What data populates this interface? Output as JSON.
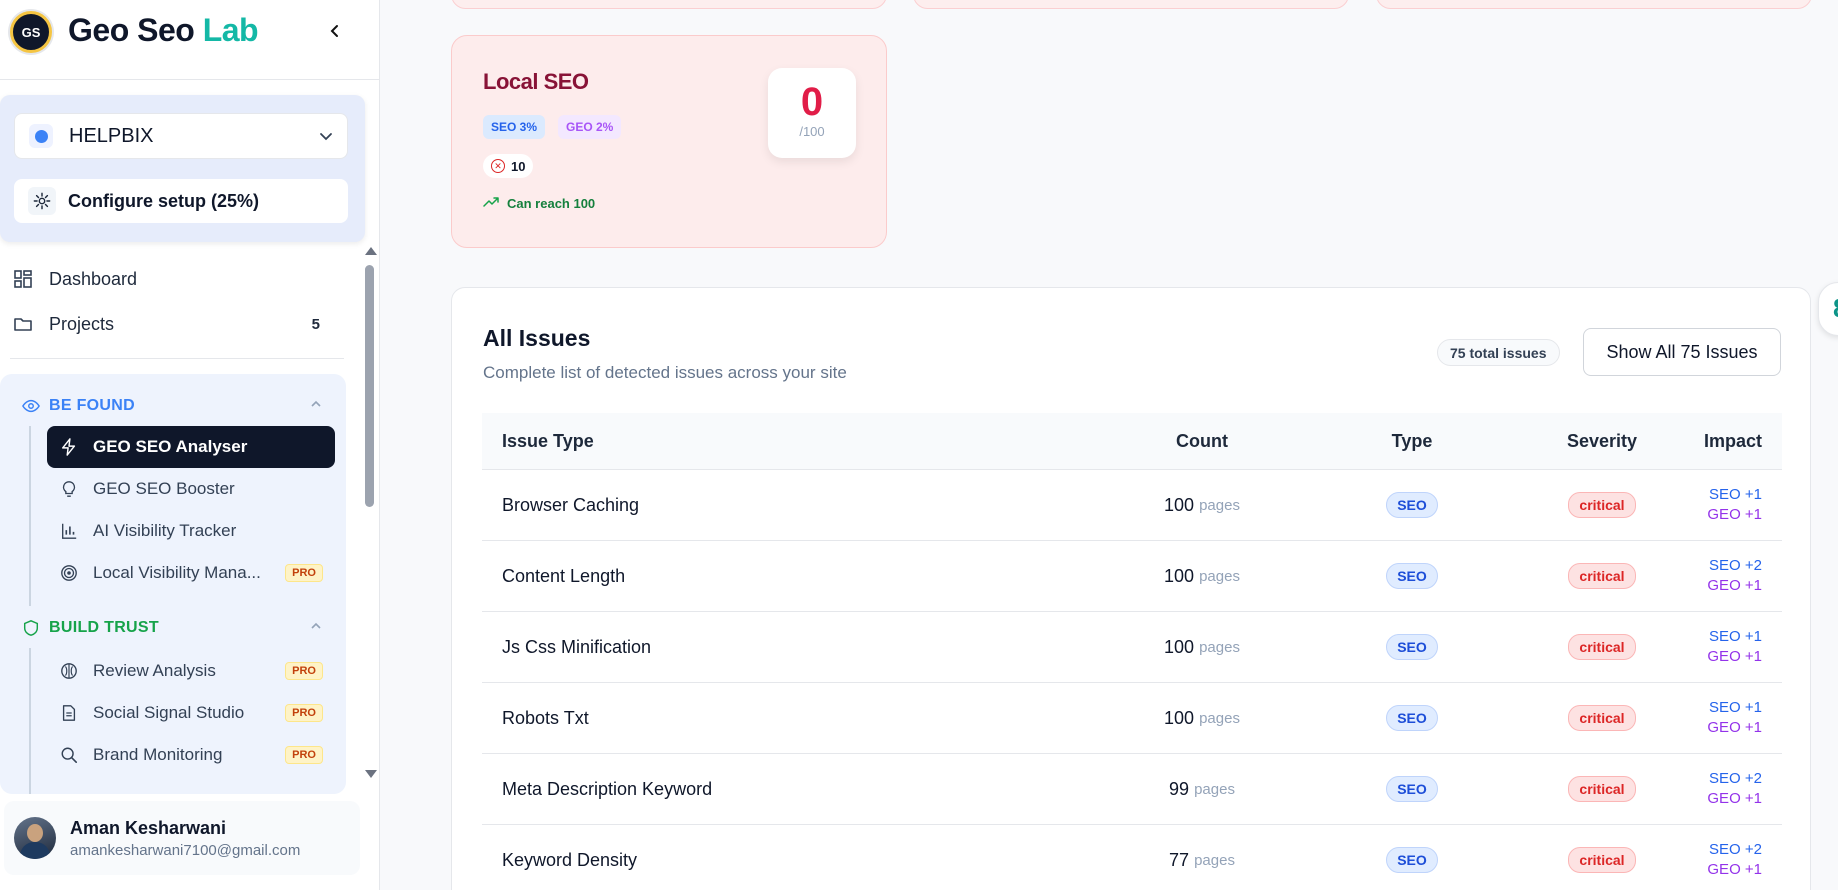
{
  "brand": {
    "logo_text": "GS",
    "name": "Geo Seo ",
    "name_accent": "Lab",
    "accent_color": "#14b8a6"
  },
  "project": {
    "name": "HELPBIX",
    "setup_label": "Configure setup (25%)"
  },
  "nav": [
    {
      "label": "Dashboard",
      "count": ""
    },
    {
      "label": "Projects",
      "count": "5"
    }
  ],
  "groups": {
    "be_found": {
      "title": "BE FOUND",
      "color": "#3b82f6",
      "items": [
        {
          "label": "GEO SEO Analyser",
          "active": true,
          "pro": ""
        },
        {
          "label": "GEO SEO Booster",
          "pro": ""
        },
        {
          "label": "AI Visibility Tracker",
          "pro": ""
        },
        {
          "label": "Local Visibility Mana...",
          "pro": "PRO"
        }
      ]
    },
    "build_trust": {
      "title": "BUILD TRUST",
      "color": "#16a34a",
      "items": [
        {
          "label": "Review Analysis",
          "pro": "PRO"
        },
        {
          "label": "Social Signal Studio",
          "pro": "PRO"
        },
        {
          "label": "Brand Monitoring",
          "pro": "PRO"
        }
      ]
    }
  },
  "user": {
    "name": "Aman Kesharwani",
    "email": "amankesharwani7100@gmail.com"
  },
  "local_seo": {
    "title": "Local SEO",
    "seo_chip": "SEO 3%",
    "geo_chip": "GEO 2%",
    "errors": "10",
    "reach_text": "Can reach 100",
    "score": "0",
    "score_max": "/100"
  },
  "issues": {
    "title": "All Issues",
    "subtitle": "Complete list of detected issues across your site",
    "total_badge": "75 total issues",
    "show_all_label": "Show All 75 Issues",
    "columns": {
      "issue_type": "Issue Type",
      "count": "Count",
      "type": "Type",
      "severity": "Severity",
      "impact": "Impact"
    },
    "unit": "pages",
    "rows": [
      {
        "issue": "Browser Caching",
        "count": "100",
        "type": "SEO",
        "severity": "critical",
        "seo_impact": "SEO +1",
        "geo_impact": "GEO +1"
      },
      {
        "issue": "Content Length",
        "count": "100",
        "type": "SEO",
        "severity": "critical",
        "seo_impact": "SEO +2",
        "geo_impact": "GEO +1"
      },
      {
        "issue": "Js Css Minification",
        "count": "100",
        "type": "SEO",
        "severity": "critical",
        "seo_impact": "SEO +1",
        "geo_impact": "GEO +1"
      },
      {
        "issue": "Robots Txt",
        "count": "100",
        "type": "SEO",
        "severity": "critical",
        "seo_impact": "SEO +1",
        "geo_impact": "GEO +1"
      },
      {
        "issue": "Meta Description Keyword",
        "count": "99",
        "type": "SEO",
        "severity": "critical",
        "seo_impact": "SEO +2",
        "geo_impact": "GEO +1"
      },
      {
        "issue": "Keyword Density",
        "count": "77",
        "type": "SEO",
        "severity": "critical",
        "seo_impact": "SEO +2",
        "geo_impact": "GEO +1"
      }
    ]
  },
  "edge_widget": {
    "glyph": "8"
  }
}
